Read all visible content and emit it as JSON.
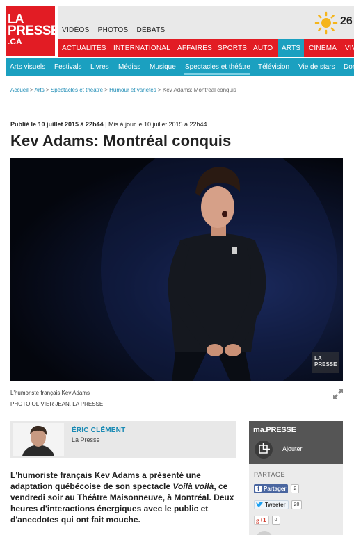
{
  "logo": {
    "line1": "LA",
    "line2": "PRESSE",
    "line3": ".CA"
  },
  "media_nav": [
    "VIDÉOS",
    "PHOTOS",
    "DÉBATS"
  ],
  "weather": {
    "temp": "26",
    "icon": "sun-icon"
  },
  "main_nav": [
    {
      "label": "ACTUALITÉS"
    },
    {
      "label": "INTERNATIONAL"
    },
    {
      "label": "AFFAIRES"
    },
    {
      "label": "SPORTS"
    },
    {
      "label": "AUTO"
    },
    {
      "label": "ARTS",
      "active": true
    },
    {
      "label": "CINÉMA"
    },
    {
      "label": "VIV"
    }
  ],
  "sub_nav": [
    {
      "label": "Arts visuels"
    },
    {
      "label": "Festivals"
    },
    {
      "label": "Livres"
    },
    {
      "label": "Médias"
    },
    {
      "label": "Musique"
    },
    {
      "label": "Spectacles et théâtre",
      "active": true
    },
    {
      "label": "Télévision"
    },
    {
      "label": "Vie de stars"
    },
    {
      "label": "Dor"
    }
  ],
  "breadcrumb": {
    "items": [
      "Accueil",
      "Arts",
      "Spectacles et théâtre",
      "Humour et variétés"
    ],
    "current": "Kev Adams: Montréal conquis",
    "separator": ">"
  },
  "article": {
    "published": "Publié le 10 juillet 2015 à 22h44",
    "updated": "Mis à jour le 10 juillet 2015 à 22h44",
    "divider": "|",
    "title": "Kev Adams: Montréal conquis",
    "photo_watermark": "LA PRESSE",
    "photo_caption": "L'humoriste français Kev Adams",
    "photo_credit": "PHOTO OLIVIER JEAN, LA PRESSE",
    "author_name": "ÉRIC CLÉMENT",
    "author_org": "La Presse",
    "lede_part1": "L'humoriste français Kev Adams a présenté une adaptation québécoise de son spectacle ",
    "lede_italic": "Voilà voilà",
    "lede_part2": ", ce vendredi soir au Théâtre Maisonneuve, à Montréal. Deux heures d'interactions énergiques avec le public et d'anecdotes qui ont fait mouche."
  },
  "sidebar": {
    "brand": "ma.PRESSE",
    "add_label": "Ajouter",
    "partage_title": "PARTAGE",
    "shares": [
      {
        "label": "Partager",
        "count": "2"
      },
      {
        "label": "Tweeter",
        "count": "20"
      },
      {
        "label": "+1",
        "count": "0"
      }
    ]
  },
  "colors": {
    "red": "#e21c24",
    "blue": "#1ba0c0",
    "link": "#1a8ab4"
  }
}
